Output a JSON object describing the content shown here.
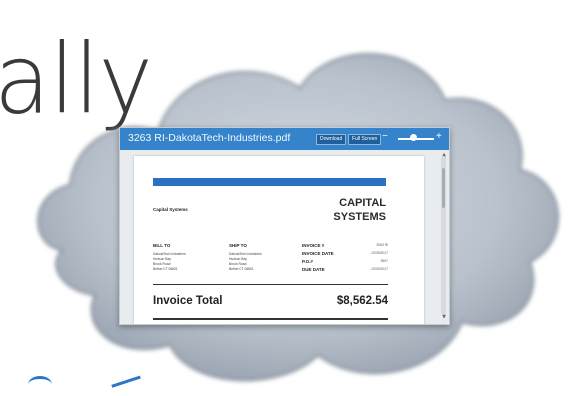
{
  "background": {
    "word": "ally",
    "accent_color": "#2a78c6"
  },
  "viewer": {
    "title": "3263 RI-DakotaTech-Industries.pdf",
    "download_label": "Download",
    "fullscreen_label": "Full Screen",
    "zoom_out": "−",
    "zoom_in": "+",
    "zoom_level": 0.35,
    "titlebar_color": "#3583cb"
  },
  "invoice": {
    "from_name": "Capital Systems",
    "brand_line1": "CAPITAL",
    "brand_line2": "SYSTEMS",
    "bill_to": {
      "heading": "BILL TO",
      "line1": "DakotaTech Industries",
      "line2": "Hudson Bay",
      "line3": "Brook Road",
      "line4": "Bethel CT 06801"
    },
    "ship_to": {
      "heading": "SHIP TO",
      "line1": "DakotaTech Industries",
      "line2": "Hudson Bay",
      "line3": "Brook Road",
      "line4": "Bethel CT 06801"
    },
    "meta": {
      "invoice_no_label": "INVOICE #",
      "invoice_no": "3263 RI",
      "invoice_date_label": "INVOICE DATE",
      "invoice_date": "02/05/2017",
      "po_label": "P.O.#",
      "po": "5507",
      "due_date_label": "DUE DATE",
      "due_date": "02/09/2017"
    },
    "total_label": "Invoice Total",
    "total_value": "$8,562.54"
  }
}
